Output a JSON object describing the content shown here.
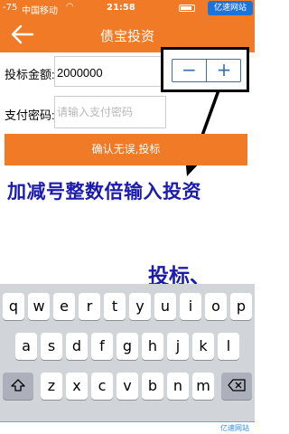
{
  "status_bar": {
    "signal": "-75",
    "carrier": "中国移动",
    "time": "21:58",
    "watermark": "亿速网站"
  },
  "nav": {
    "back_icon": "back-arrow-icon",
    "title": "债宝投资"
  },
  "form": {
    "amount_label": "投标金额:",
    "amount_value": "2000000",
    "password_label": "支付密码:",
    "password_placeholder": "请输入支付密码"
  },
  "stepper": {
    "minus": "−",
    "plus": "+"
  },
  "confirm_button": "确认无误,投标",
  "annotations": {
    "note1": "加减号整数倍输入投资",
    "note2": "投标、"
  },
  "keyboard": {
    "row1": [
      "q",
      "w",
      "e",
      "r",
      "t",
      "y",
      "u",
      "i",
      "o",
      "p"
    ],
    "row2": [
      "a",
      "s",
      "d",
      "f",
      "g",
      "h",
      "j",
      "k",
      "l"
    ],
    "row3": [
      "z",
      "x",
      "c",
      "v",
      "b",
      "n",
      "m"
    ],
    "shift_icon": "shift-icon",
    "delete_icon": "delete-icon"
  },
  "colors": {
    "brand": "#f07a25",
    "annotation": "#1b1bb0",
    "stepper": "#3a6fb0"
  }
}
